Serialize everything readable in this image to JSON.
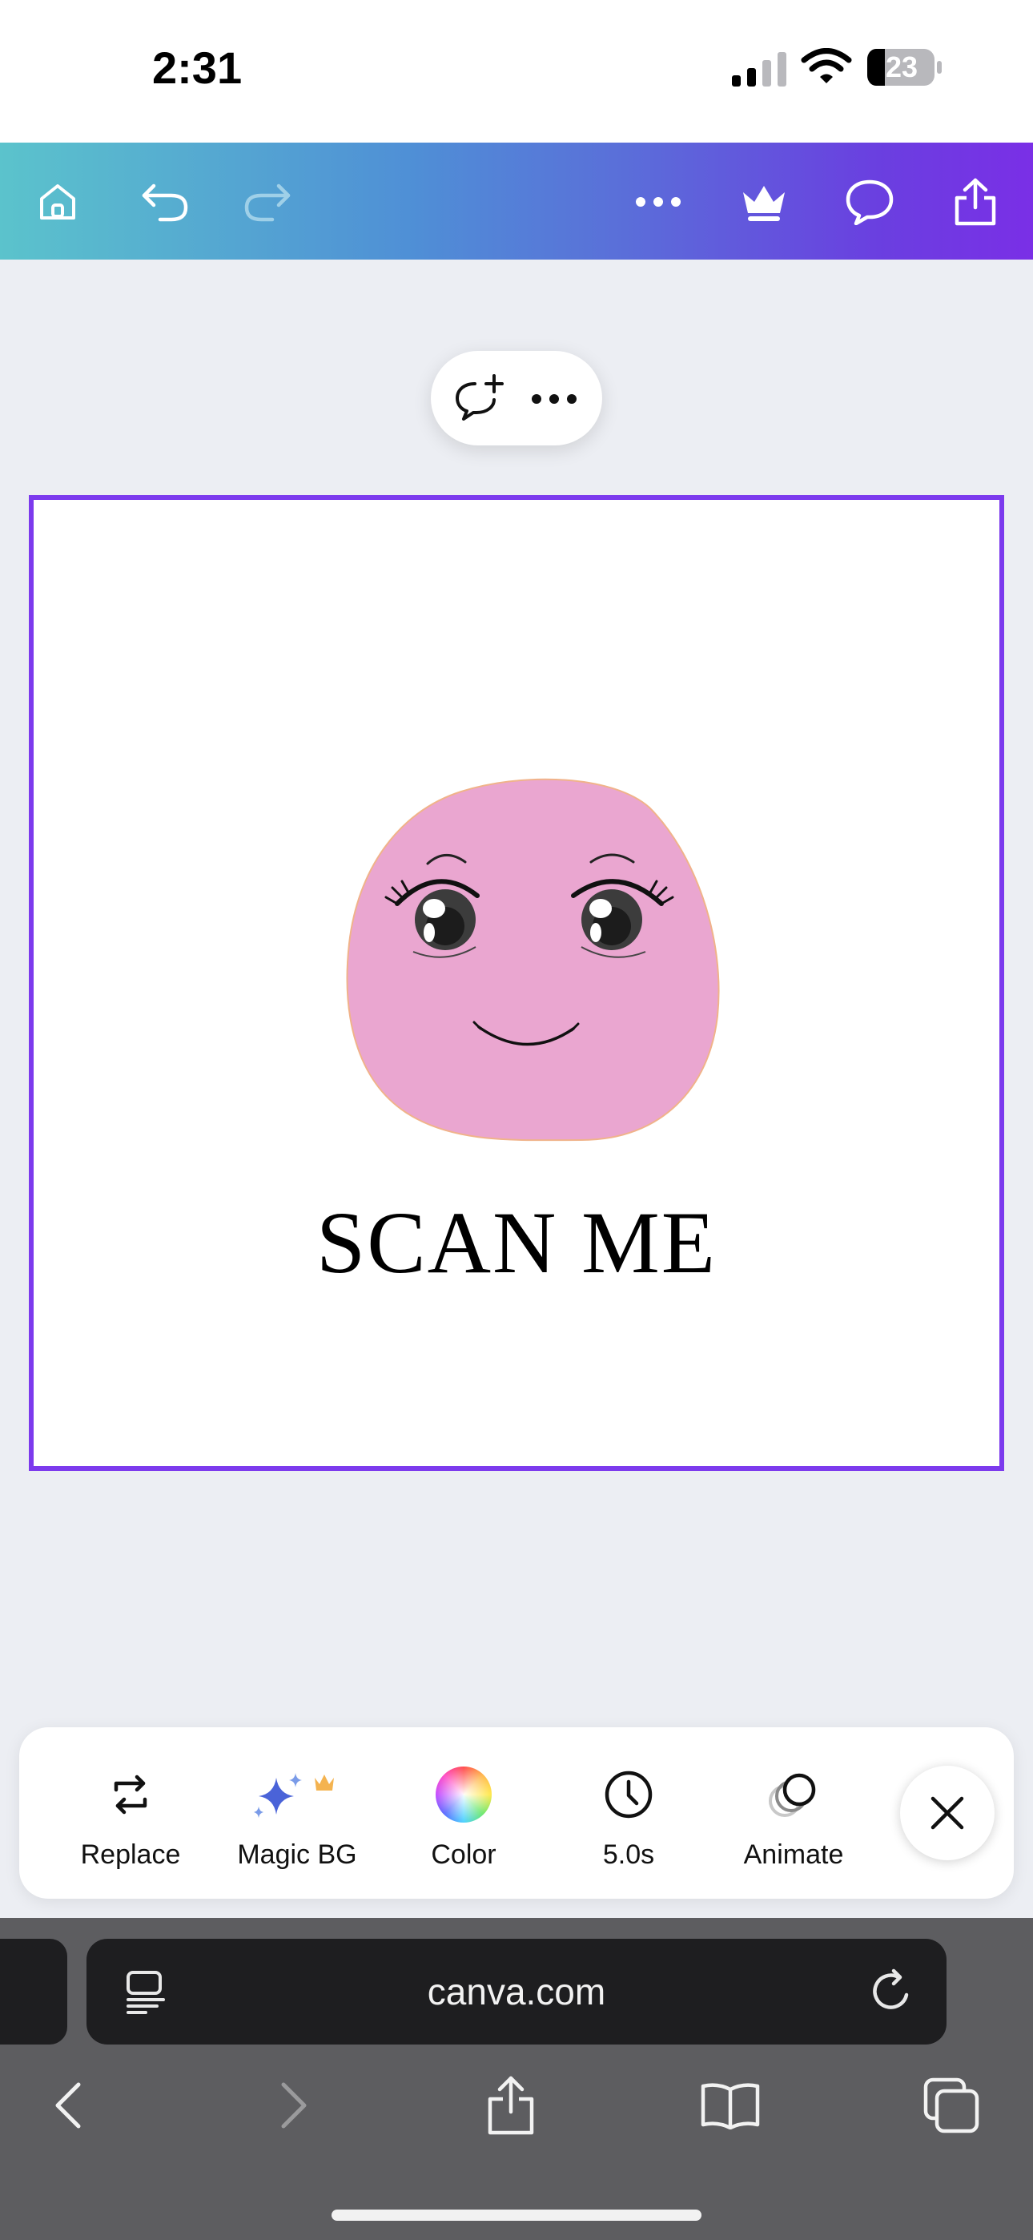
{
  "status_bar": {
    "time": "2:31",
    "battery": "23"
  },
  "editor_toolbar": {
    "icons": [
      "home-icon",
      "undo-icon",
      "redo-icon",
      "more-icon",
      "crown-icon",
      "comment-icon",
      "share-icon"
    ],
    "gradient": [
      "#5bc3cc",
      "#7a2fe6"
    ]
  },
  "mini_toolbar": {
    "icons": [
      "add-comment-icon",
      "more-icon"
    ]
  },
  "canvas": {
    "title": "SCAN ME",
    "selection_color": "#7c3aed",
    "blob_color": "#eaa6d0"
  },
  "context_toolbar": {
    "items": [
      {
        "label": "Replace",
        "icon": "replace-icon"
      },
      {
        "label": "Magic BG",
        "icon": "magic-sparkle-icon"
      },
      {
        "label": "Color",
        "icon": "color-wheel-icon"
      },
      {
        "label": "5.0s",
        "icon": "clock-icon"
      },
      {
        "label": "Animate",
        "icon": "animate-icon"
      }
    ],
    "close_icon": "close-icon"
  },
  "browser": {
    "url": "canva.com",
    "nav_icons": [
      "back-icon",
      "forward-icon",
      "share-icon",
      "bookmarks-icon",
      "tabs-icon"
    ]
  }
}
